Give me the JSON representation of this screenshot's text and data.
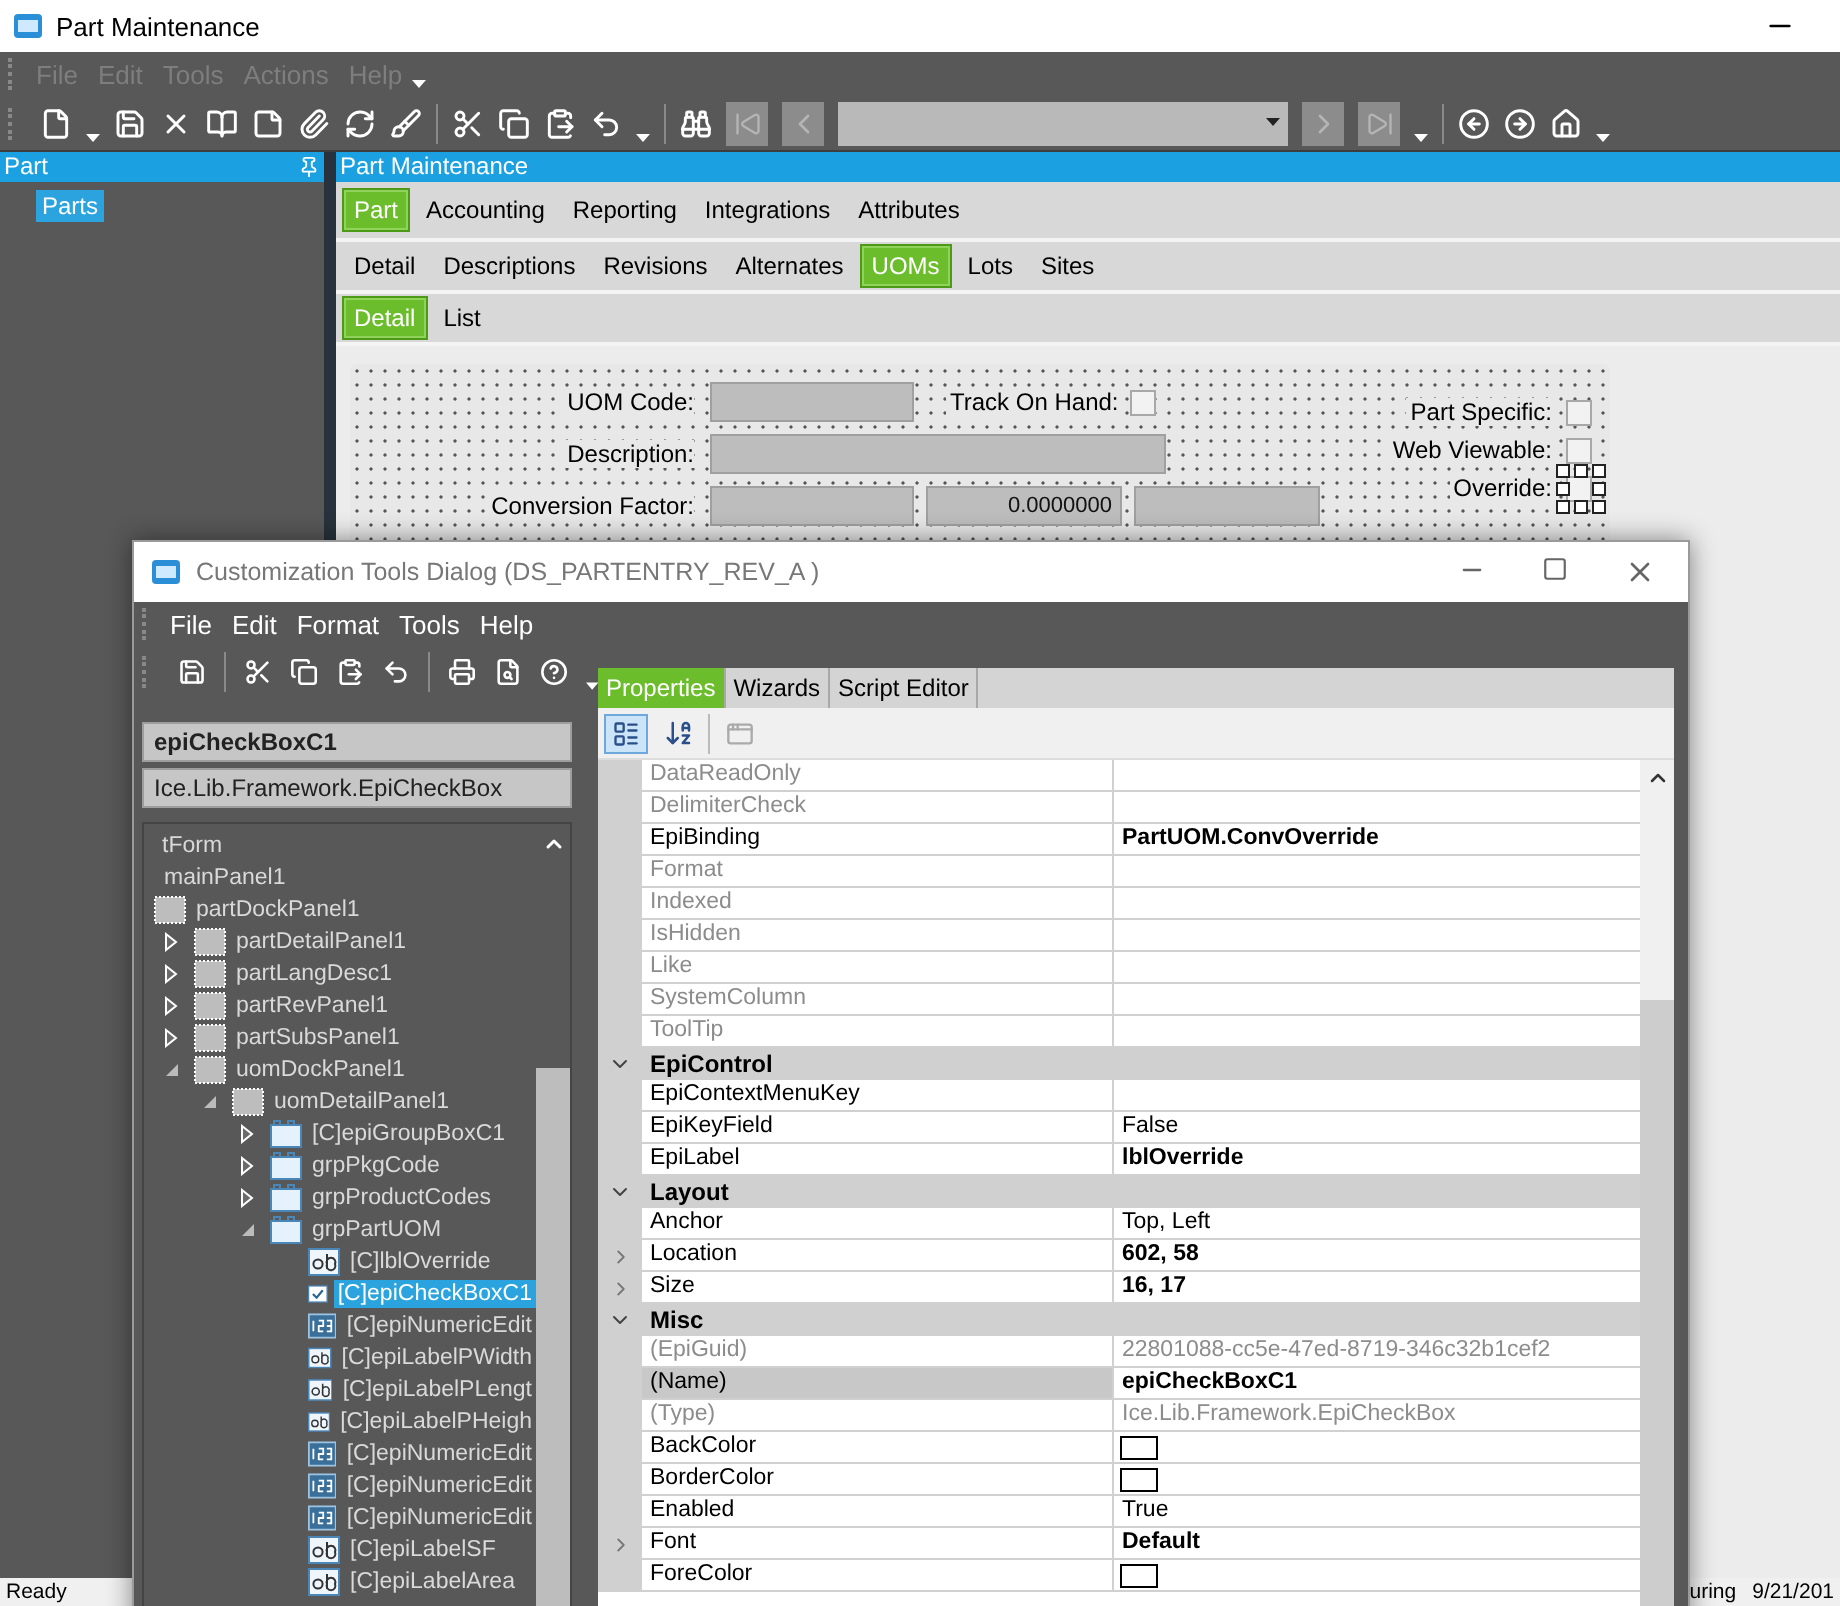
{
  "window": {
    "title": "Part Maintenance"
  },
  "menu": [
    {
      "label": "File",
      "disabled": true
    },
    {
      "label": "Edit",
      "disabled": true
    },
    {
      "label": "Tools",
      "disabled": true
    },
    {
      "label": "Actions",
      "disabled": true
    },
    {
      "label": "Help",
      "disabled": true
    }
  ],
  "side_panel": {
    "title": "Part",
    "items": [
      {
        "label": "Parts",
        "selected": true
      }
    ]
  },
  "content": {
    "title": "Part Maintenance",
    "tabs": [
      {
        "label": "Part",
        "selected": true
      },
      {
        "label": "Accounting",
        "selected": false
      },
      {
        "label": "Reporting",
        "selected": false
      },
      {
        "label": "Integrations",
        "selected": false
      },
      {
        "label": "Attributes",
        "selected": false
      }
    ],
    "sub_tabs": [
      {
        "label": "Detail",
        "selected": false
      },
      {
        "label": "Descriptions",
        "selected": false
      },
      {
        "label": "Revisions",
        "selected": false
      },
      {
        "label": "Alternates",
        "selected": false
      },
      {
        "label": "UOMs",
        "selected": true
      },
      {
        "label": "Lots",
        "selected": false
      },
      {
        "label": "Sites",
        "selected": false
      }
    ],
    "detail_tabs": [
      {
        "label": "Detail",
        "selected": true
      },
      {
        "label": "List",
        "selected": false
      }
    ],
    "form": {
      "uom_code": {
        "label": "UOM Code:"
      },
      "track_on_hand": {
        "label": "Track On Hand:",
        "checked": false
      },
      "description": {
        "label": "Description:"
      },
      "conversion_factor": {
        "label": "Conversion Factor:",
        "value": "0.0000000"
      },
      "checks": [
        {
          "label": "Part Specific:",
          "checked": false,
          "selected": false
        },
        {
          "label": "Web Viewable:",
          "checked": false,
          "selected": false
        },
        {
          "label": "Override:",
          "checked": false,
          "selected": true
        }
      ]
    }
  },
  "status_bar": {
    "left": "Ready",
    "right": [
      "uring",
      "9/21/201"
    ]
  },
  "dialog": {
    "title": "Customization Tools Dialog  (DS_PARTENTRY_REV_A )",
    "menu": [
      "File",
      "Edit",
      "Format",
      "Tools",
      "Help"
    ],
    "control_name": "epiCheckBoxC1",
    "control_type": "Ice.Lib.Framework.EpiCheckBox",
    "tree": [
      {
        "label": "tForm",
        "selected": false,
        "children": [
          {
            "label": "mainPanel1",
            "selected": false,
            "children": [
              {
                "label": "partDockPanel1",
                "kind": "panel",
                "selected": false,
                "children": [
                  {
                    "label": "partDetailPanel1",
                    "kind": "panel",
                    "expanded": false,
                    "selected": false
                  },
                  {
                    "label": "partLangDesc1",
                    "kind": "panel",
                    "expanded": false,
                    "selected": false
                  },
                  {
                    "label": "partRevPanel1",
                    "kind": "panel",
                    "expanded": false,
                    "selected": false
                  },
                  {
                    "label": "partSubsPanel1",
                    "kind": "panel",
                    "expanded": false,
                    "selected": false
                  },
                  {
                    "label": "uomDockPanel1",
                    "kind": "panel",
                    "expanded": true,
                    "selected": false,
                    "children": [
                      {
                        "label": "uomDetailPanel1",
                        "kind": "panel",
                        "expanded": true,
                        "selected": false,
                        "children": [
                          {
                            "label": "[C]epiGroupBoxC1",
                            "kind": "group",
                            "expanded": false,
                            "selected": false
                          },
                          {
                            "label": "grpPkgCode",
                            "kind": "group",
                            "expanded": false,
                            "selected": false
                          },
                          {
                            "label": "grpProductCodes",
                            "kind": "group",
                            "expanded": false,
                            "selected": false
                          },
                          {
                            "label": "grpPartUOM",
                            "kind": "group",
                            "expanded": true,
                            "selected": false,
                            "children": [
                              {
                                "label": "[C]lblOverride",
                                "kind": "label",
                                "selected": false
                              },
                              {
                                "label": "[C]epiCheckBoxC1",
                                "kind": "checkbox",
                                "selected": true
                              },
                              {
                                "label": "[C]epiNumericEdit",
                                "kind": "numeric",
                                "selected": false
                              },
                              {
                                "label": "[C]epiLabelPWidth",
                                "kind": "label",
                                "selected": false
                              },
                              {
                                "label": "[C]epiLabelPLengt",
                                "kind": "label",
                                "selected": false
                              },
                              {
                                "label": "[C]epiLabelPHeigh",
                                "kind": "label",
                                "selected": false
                              },
                              {
                                "label": "[C]epiNumericEdit",
                                "kind": "numeric",
                                "selected": false
                              },
                              {
                                "label": "[C]epiNumericEdit",
                                "kind": "numeric",
                                "selected": false
                              },
                              {
                                "label": "[C]epiNumericEdit",
                                "kind": "numeric",
                                "selected": false
                              },
                              {
                                "label": "[C]epiLabelSF",
                                "kind": "label",
                                "selected": false
                              },
                              {
                                "label": "[C]epiLabelArea",
                                "kind": "label",
                                "selected": false
                              }
                            ]
                          }
                        ]
                      }
                    ]
                  }
                ]
              }
            ]
          }
        ]
      }
    ],
    "tabs": [
      {
        "label": "Properties",
        "selected": true
      },
      {
        "label": "Wizards",
        "selected": false
      },
      {
        "label": "Script Editor",
        "selected": false
      }
    ],
    "grid_tools": [
      {
        "kind": "categorized",
        "selected": true
      },
      {
        "kind": "alphabetical",
        "selected": false
      },
      {
        "kind": "pages",
        "selected": false
      }
    ],
    "properties": [
      {
        "kind": "property",
        "name": "DataReadOnly",
        "readonly": true,
        "expandable": false,
        "selected": false
      },
      {
        "kind": "property",
        "name": "DelimiterCheck",
        "readonly": true,
        "expandable": false,
        "selected": false
      },
      {
        "kind": "property",
        "name": "EpiBinding",
        "value": "PartUOM.ConvOverride",
        "readonly": false,
        "modified": true,
        "expandable": false,
        "selected": false
      },
      {
        "kind": "property",
        "name": "Format",
        "readonly": true,
        "expandable": false,
        "selected": false
      },
      {
        "kind": "property",
        "name": "Indexed",
        "readonly": true,
        "expandable": false,
        "selected": false
      },
      {
        "kind": "property",
        "name": "IsHidden",
        "readonly": true,
        "expandable": false,
        "selected": false
      },
      {
        "kind": "property",
        "name": "Like",
        "readonly": true,
        "expandable": false,
        "selected": false
      },
      {
        "kind": "property",
        "name": "SystemColumn",
        "readonly": true,
        "expandable": false,
        "selected": false
      },
      {
        "kind": "property",
        "name": "ToolTip",
        "readonly": true,
        "expandable": false,
        "selected": false
      },
      {
        "kind": "category",
        "name": "EpiControl",
        "expanded": true
      },
      {
        "kind": "property",
        "name": "EpiContextMenuKey",
        "readonly": false,
        "expandable": false,
        "selected": false
      },
      {
        "kind": "property",
        "name": "EpiKeyField",
        "value": "False",
        "readonly": false,
        "modified": false,
        "expandable": false,
        "selected": false
      },
      {
        "kind": "property",
        "name": "EpiLabel",
        "value": "lblOverride",
        "readonly": false,
        "modified": true,
        "expandable": false,
        "selected": false
      },
      {
        "kind": "category",
        "name": "Layout",
        "expanded": true
      },
      {
        "kind": "property",
        "name": "Anchor",
        "value": "Top, Left",
        "readonly": false,
        "modified": false,
        "expandable": false,
        "selected": false
      },
      {
        "kind": "property",
        "name": "Location",
        "value": "602, 58",
        "readonly": false,
        "modified": true,
        "expandable": true,
        "selected": false
      },
      {
        "kind": "property",
        "name": "Size",
        "value": "16, 17",
        "readonly": false,
        "modified": true,
        "expandable": true,
        "selected": false
      },
      {
        "kind": "category",
        "name": "Misc",
        "expanded": true
      },
      {
        "kind": "property",
        "name": "(EpiGuid)",
        "value": "22801088-cc5e-47ed-8719-346c32b1cef2",
        "readonly": true,
        "modified": false,
        "expandable": false,
        "selected": false
      },
      {
        "kind": "property",
        "name": "(Name)",
        "value": "epiCheckBoxC1",
        "readonly": false,
        "modified": true,
        "expandable": false,
        "selected": true
      },
      {
        "kind": "property",
        "name": "(Type)",
        "value": "Ice.Lib.Framework.EpiCheckBox",
        "readonly": true,
        "modified": false,
        "expandable": false,
        "selected": false
      },
      {
        "kind": "color",
        "name": "BackColor",
        "color": "#ffffff"
      },
      {
        "kind": "color",
        "name": "BorderColor",
        "color": "#ffffff"
      },
      {
        "kind": "property",
        "name": "Enabled",
        "value": "True",
        "readonly": false,
        "modified": false,
        "expandable": false,
        "selected": false
      },
      {
        "kind": "property",
        "name": "Font",
        "value": "Default",
        "readonly": false,
        "modified": true,
        "expandable": true,
        "selected": false
      },
      {
        "kind": "color",
        "name": "ForeColor",
        "color": "#ffffff"
      }
    ]
  }
}
